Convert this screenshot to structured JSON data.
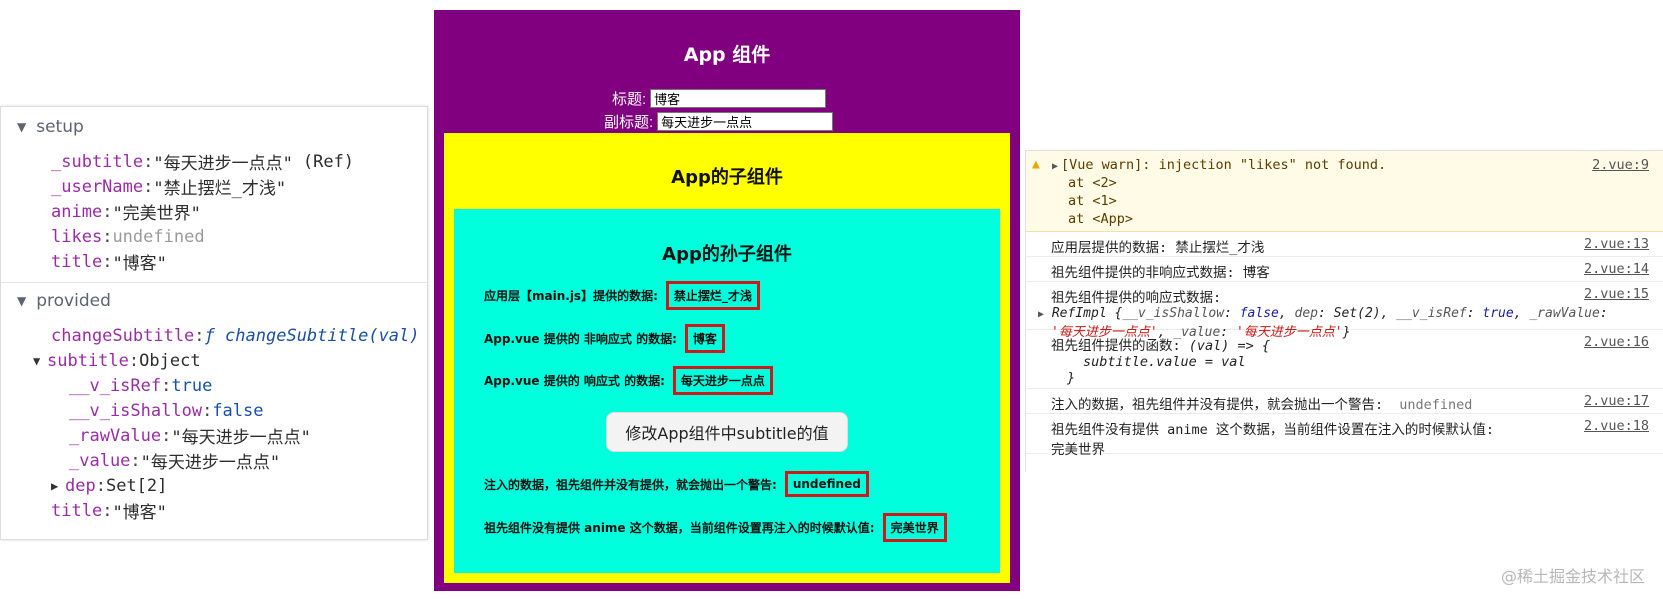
{
  "devtools": {
    "setup": {
      "header": "setup",
      "rows": [
        {
          "key": "_subtitle",
          "value": "\"每天进步一点点\"",
          "tag": "(Ref)"
        },
        {
          "key": "_userName",
          "value": "\"禁止摆烂_才浅\""
        },
        {
          "key": "anime",
          "value": "\"完美世界\""
        },
        {
          "key": "likes",
          "value": "undefined"
        },
        {
          "key": "title",
          "value": "\"博客\""
        }
      ]
    },
    "provided": {
      "header": "provided",
      "change_subtitle_key": "changeSubtitle",
      "change_subtitle_f": "ƒ",
      "change_subtitle_sig": "changeSubtitle(val)",
      "subtitle_key": "subtitle",
      "subtitle_type": "Object",
      "is_ref_key": "__v_isRef",
      "is_ref_val": "true",
      "is_shallow_key": "__v_isShallow",
      "is_shallow_val": "false",
      "raw_key": "_rawValue",
      "raw_val": "\"每天进步一点点\"",
      "value_key": "_value",
      "value_val": "\"每天进步一点点\"",
      "dep_key": "dep",
      "dep_val": "Set[2]",
      "title_key": "title",
      "title_val": "\"博客\""
    }
  },
  "app": {
    "title": "App 组件",
    "title_label": "标题:",
    "title_value": "博客",
    "subtitle_label": "副标题:",
    "subtitle_value": "每天进步一点点",
    "child": {
      "title": "App的子组件",
      "grandchild": {
        "title": "App的孙子组件",
        "row1_label": "应用层【main.js】提供的数据:",
        "row1_value": "禁止摆烂_才浅",
        "row2_label": "App.vue 提供的 非响应式 的数据:",
        "row2_value": "博客",
        "row3_label": "App.vue 提供的 响应式 的数据:",
        "row3_value": "每天进步一点点",
        "button_label": "修改App组件中subtitle的值",
        "row4_label": "注入的数据，祖先组件并没有提供，就会抛出一个警告:",
        "row4_value": "undefined",
        "row5_label": "祖先组件没有提供 anime 这个数据，当前组件设置再注入的时候默认值:",
        "row5_value": "完美世界"
      }
    }
  },
  "console": {
    "warn": {
      "text": "[Vue warn]: injection \"likes\" not found.",
      "at1": "at <2>",
      "at2": "at <1>",
      "at3": "at <App>",
      "link": "2.vue:9"
    },
    "log1": {
      "text": "应用层提供的数据:  禁止摆烂_才浅",
      "link": "2.vue:13"
    },
    "log2": {
      "text": "祖先组件提供的非响应式数据:  博客",
      "link": "2.vue:14"
    },
    "log3": {
      "text": "祖先组件提供的响应式数据:",
      "link": "2.vue:15",
      "ref_prefix": "RefImpl {",
      "k1": "__v_isShallow",
      "v1": "false",
      "k2": "dep",
      "v2": "Set(2)",
      "k3": "__v_isRef",
      "v3": "true",
      "k4": "_rawValue",
      "v4": "'每天进步一点点'",
      "k5": "_value",
      "v5": "'每天进步一点点'",
      "suffix": "}"
    },
    "log4": {
      "text": "祖先组件提供的函数:",
      "fn_line1": "(val) => {",
      "fn_line2": "subtitle.value = val",
      "fn_line3": "}",
      "link": "2.vue:16"
    },
    "log5": {
      "text": "注入的数据，祖先组件并没有提供，就会抛出一个警告:",
      "value": "undefined",
      "link": "2.vue:17"
    },
    "log6": {
      "text": "祖先组件没有提供 anime 这个数据，当前组件设置在注入的时候默认值:",
      "text2": "完美世界",
      "link": "2.vue:18"
    }
  },
  "watermark": "@稀土掘金技术社区"
}
